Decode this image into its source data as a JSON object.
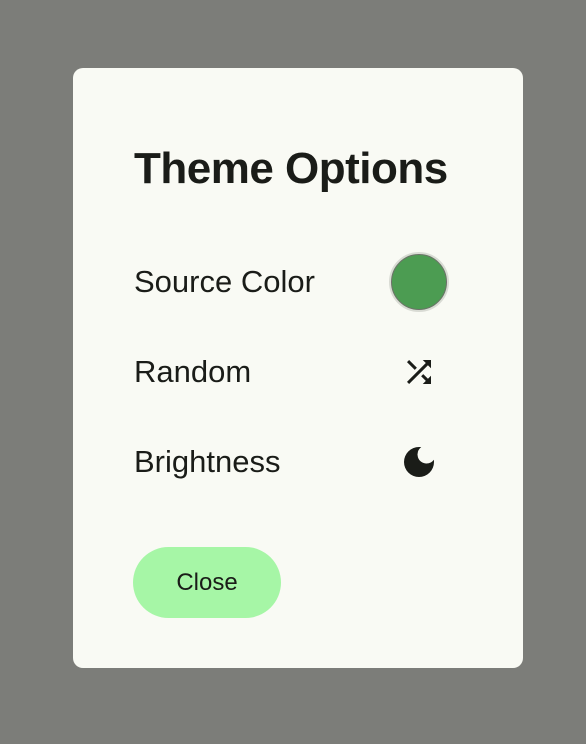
{
  "dialog": {
    "title": "Theme Options",
    "rows": [
      {
        "label": "Source Color",
        "control": "color-swatch",
        "color": "#4c9c52"
      },
      {
        "label": "Random",
        "control": "shuffle-icon"
      },
      {
        "label": "Brightness",
        "control": "dark-mode-moon-icon"
      }
    ],
    "close_label": "Close"
  },
  "colors": {
    "scrim": "#7c7d79",
    "surface": "#f9faf4",
    "button": "#a6f6a6",
    "text": "#1a1c18"
  }
}
